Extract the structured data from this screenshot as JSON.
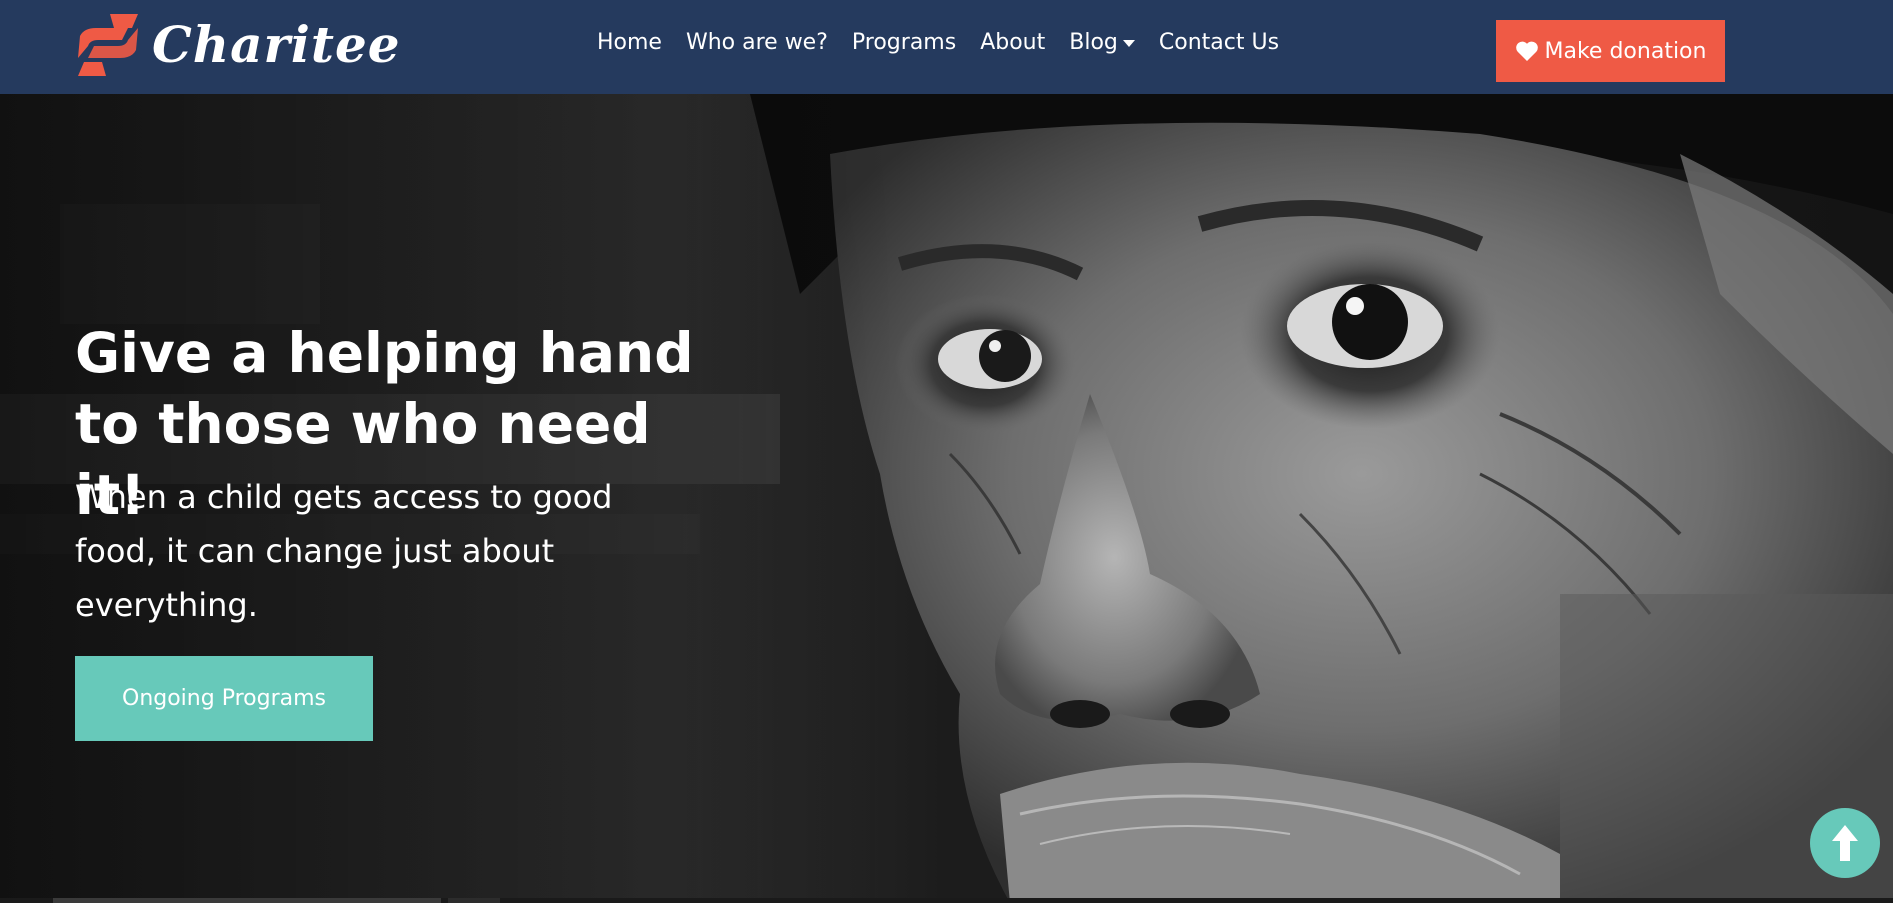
{
  "brand": {
    "name": "Charitee",
    "accent_color": "#ef5a45"
  },
  "nav": {
    "background_color": "#253a5e",
    "items": [
      {
        "label": "Home",
        "has_dropdown": false
      },
      {
        "label": "Who are we?",
        "has_dropdown": false
      },
      {
        "label": "Programs",
        "has_dropdown": false
      },
      {
        "label": "About",
        "has_dropdown": false
      },
      {
        "label": "Blog",
        "has_dropdown": true
      },
      {
        "label": "Contact Us",
        "has_dropdown": false
      }
    ],
    "donate": {
      "label": "Make donation",
      "icon": "heart-icon",
      "color": "#ef5a45"
    }
  },
  "hero": {
    "title": "Give a helping hand to those who need it!",
    "subtitle": "When a child gets access to good food, it can change just about everything.",
    "cta_label": "Ongoing Programs",
    "cta_color": "#67c9ba"
  },
  "back_to_top": {
    "icon": "arrow-up-icon",
    "color": "#67c9ba"
  }
}
